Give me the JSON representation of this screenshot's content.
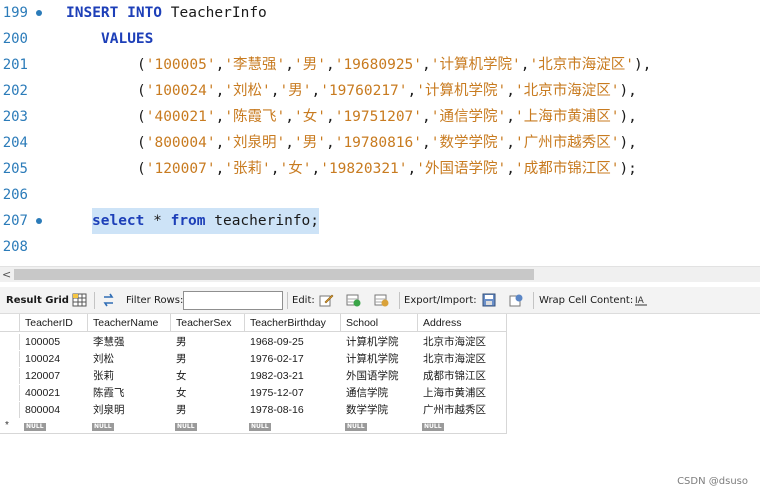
{
  "editor": {
    "lines": [
      {
        "num": "199",
        "tokens": [
          {
            "t": "INSERT INTO",
            "k": "kw"
          },
          {
            "t": " TeacherInfo",
            "k": "punct"
          }
        ]
      },
      {
        "num": "200",
        "tokens": [
          {
            "t": "VALUES",
            "k": "kw"
          }
        ]
      },
      {
        "num": "201",
        "tokens": [
          {
            "t": "(",
            "k": "punct"
          },
          {
            "t": "'100005'",
            "k": "str"
          },
          {
            "t": ",",
            "k": "punct"
          },
          {
            "t": "'李慧强'",
            "k": "str"
          },
          {
            "t": ",",
            "k": "punct"
          },
          {
            "t": "'男'",
            "k": "str"
          },
          {
            "t": ",",
            "k": "punct"
          },
          {
            "t": "'19680925'",
            "k": "str"
          },
          {
            "t": ",",
            "k": "punct"
          },
          {
            "t": "'计算机学院'",
            "k": "str"
          },
          {
            "t": ",",
            "k": "punct"
          },
          {
            "t": "'北京市海淀区'",
            "k": "str"
          },
          {
            "t": "),",
            "k": "punct"
          }
        ]
      },
      {
        "num": "202",
        "tokens": [
          {
            "t": "(",
            "k": "punct"
          },
          {
            "t": "'100024'",
            "k": "str"
          },
          {
            "t": ",",
            "k": "punct"
          },
          {
            "t": "'刘松'",
            "k": "str"
          },
          {
            "t": ",",
            "k": "punct"
          },
          {
            "t": "'男'",
            "k": "str"
          },
          {
            "t": ",",
            "k": "punct"
          },
          {
            "t": "'19760217'",
            "k": "str"
          },
          {
            "t": ",",
            "k": "punct"
          },
          {
            "t": "'计算机学院'",
            "k": "str"
          },
          {
            "t": ",",
            "k": "punct"
          },
          {
            "t": "'北京市海淀区'",
            "k": "str"
          },
          {
            "t": "),",
            "k": "punct"
          }
        ]
      },
      {
        "num": "203",
        "tokens": [
          {
            "t": "(",
            "k": "punct"
          },
          {
            "t": "'400021'",
            "k": "str"
          },
          {
            "t": ",",
            "k": "punct"
          },
          {
            "t": "'陈霞飞'",
            "k": "str"
          },
          {
            "t": ",",
            "k": "punct"
          },
          {
            "t": "'女'",
            "k": "str"
          },
          {
            "t": ",",
            "k": "punct"
          },
          {
            "t": "'19751207'",
            "k": "str"
          },
          {
            "t": ",",
            "k": "punct"
          },
          {
            "t": "'通信学院'",
            "k": "str"
          },
          {
            "t": ",",
            "k": "punct"
          },
          {
            "t": "'上海市黄浦区'",
            "k": "str"
          },
          {
            "t": "),",
            "k": "punct"
          }
        ]
      },
      {
        "num": "204",
        "tokens": [
          {
            "t": "(",
            "k": "punct"
          },
          {
            "t": "'800004'",
            "k": "str"
          },
          {
            "t": ",",
            "k": "punct"
          },
          {
            "t": "'刘泉明'",
            "k": "str"
          },
          {
            "t": ",",
            "k": "punct"
          },
          {
            "t": "'男'",
            "k": "str"
          },
          {
            "t": ",",
            "k": "punct"
          },
          {
            "t": "'19780816'",
            "k": "str"
          },
          {
            "t": ",",
            "k": "punct"
          },
          {
            "t": "'数学学院'",
            "k": "str"
          },
          {
            "t": ",",
            "k": "punct"
          },
          {
            "t": "'广州市越秀区'",
            "k": "str"
          },
          {
            "t": "),",
            "k": "punct"
          }
        ]
      },
      {
        "num": "205",
        "tokens": [
          {
            "t": "(",
            "k": "punct"
          },
          {
            "t": "'120007'",
            "k": "str"
          },
          {
            "t": ",",
            "k": "punct"
          },
          {
            "t": "'张莉'",
            "k": "str"
          },
          {
            "t": ",",
            "k": "punct"
          },
          {
            "t": "'女'",
            "k": "str"
          },
          {
            "t": ",",
            "k": "punct"
          },
          {
            "t": "'19820321'",
            "k": "str"
          },
          {
            "t": ",",
            "k": "punct"
          },
          {
            "t": "'外国语学院'",
            "k": "str"
          },
          {
            "t": ",",
            "k": "punct"
          },
          {
            "t": "'成都市锦江区'",
            "k": "str"
          },
          {
            "t": ");",
            "k": "punct"
          }
        ]
      },
      {
        "num": "206",
        "tokens": []
      },
      {
        "num": "207",
        "tokens": [
          {
            "t": "select",
            "k": "kw"
          },
          {
            "t": " * ",
            "k": "punct"
          },
          {
            "t": "from",
            "k": "kw"
          },
          {
            "t": " teacherinfo;",
            "k": "punct"
          }
        ]
      },
      {
        "num": "208",
        "tokens": []
      }
    ]
  },
  "toolbar": {
    "result_grid": "Result Grid",
    "filter_rows": "Filter Rows:",
    "filter_value": "",
    "edit": "Edit:",
    "export_import": "Export/Import:",
    "wrap_cell": "Wrap Cell Content:"
  },
  "grid": {
    "columns": [
      "TeacherID",
      "TeacherName",
      "TeacherSex",
      "TeacherBirthday",
      "School",
      "Address"
    ],
    "rows": [
      [
        "100005",
        "李慧强",
        "男",
        "1968-09-25",
        "计算机学院",
        "北京市海淀区"
      ],
      [
        "100024",
        "刘松",
        "男",
        "1976-02-17",
        "计算机学院",
        "北京市海淀区"
      ],
      [
        "120007",
        "张莉",
        "女",
        "1982-03-21",
        "外国语学院",
        "成都市锦江区"
      ],
      [
        "400021",
        "陈霞飞",
        "女",
        "1975-12-07",
        "通信学院",
        "上海市黄浦区"
      ],
      [
        "800004",
        "刘泉明",
        "男",
        "1978-08-16",
        "数学学院",
        "广州市越秀区"
      ]
    ],
    "null_label": "NULL",
    "new_row_marker": "*"
  },
  "watermark": "CSDN @dsuso",
  "colors": {
    "keyword": "#1d3fb8",
    "string": "#c87b20",
    "line_number": "#2b7bb9",
    "selection": "#cde3f7"
  }
}
